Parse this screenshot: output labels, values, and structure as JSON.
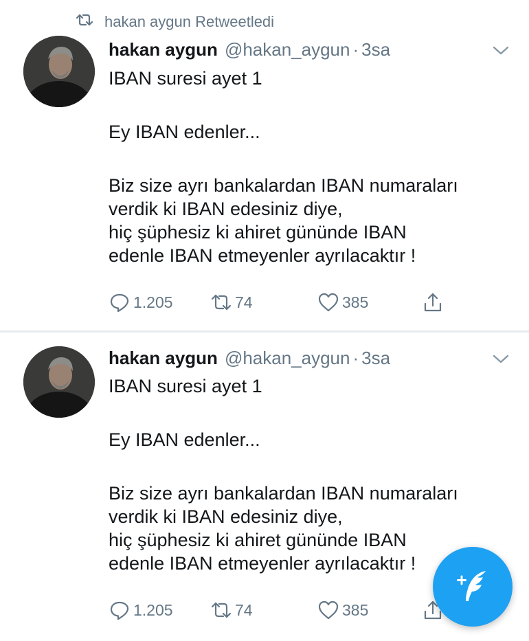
{
  "colors": {
    "accent": "#1da1f2",
    "secondary_text": "#657786",
    "divider": "#e6ecf0"
  },
  "tweets": [
    {
      "retweet_label": "hakan aygun Retweetledi",
      "name": "hakan aygun",
      "handle": "@hakan_aygun",
      "dot": "·",
      "time": "3sa",
      "lines": [
        "IBAN suresi ayet 1",
        "Ey IBAN edenler...",
        "Biz size ayrı bankalardan IBAN numaraları",
        "verdik ki IBAN edesiniz diye,",
        "hiç şüphesiz ki ahiret gününde IBAN",
        "edenle IBAN etmeyenler ayrılacaktır !"
      ],
      "replies": "1.205",
      "retweets": "74",
      "likes": "385"
    },
    {
      "name": "hakan aygun",
      "handle": "@hakan_aygun",
      "dot": "·",
      "time": "3sa",
      "lines": [
        "IBAN suresi ayet 1",
        "Ey IBAN edenler...",
        "Biz size ayrı bankalardan IBAN numaraları",
        "verdik ki IBAN edesiniz diye,",
        "hiç şüphesiz ki ahiret gününde IBAN",
        "edenle IBAN etmeyenler ayrılacaktır !"
      ],
      "replies": "1.205",
      "retweets": "74",
      "likes": "385"
    }
  ],
  "icons": {
    "retweet_context": "retweet-icon",
    "caret": "chevron-down-icon",
    "reply": "reply-icon",
    "retweet": "retweet-icon",
    "like": "heart-icon",
    "share": "share-icon",
    "compose": "compose-tweet-icon"
  }
}
